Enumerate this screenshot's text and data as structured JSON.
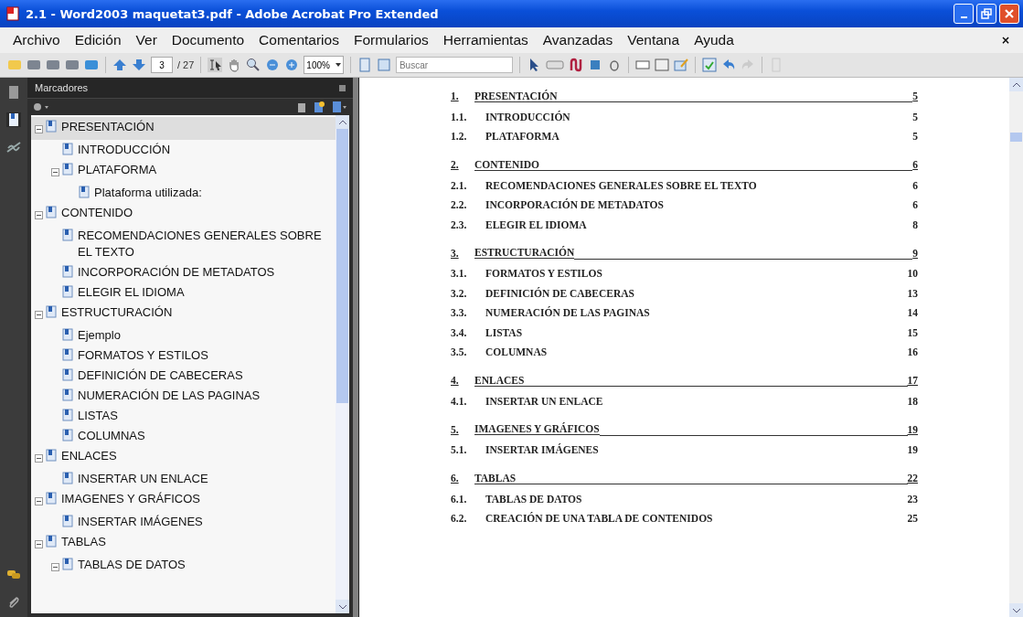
{
  "window": {
    "title": "2.1 - Word2003 maquetat3.pdf - Adobe Acrobat Pro Extended"
  },
  "menu": [
    "Archivo",
    "Edición",
    "Ver",
    "Documento",
    "Comentarios",
    "Formularios",
    "Herramientas",
    "Avanzadas",
    "Ventana",
    "Ayuda"
  ],
  "menu_close": "×",
  "toolbar": {
    "page": "3",
    "page_count": "/ 27",
    "zoom": "100%",
    "search": {
      "placeholder": "Buscar"
    }
  },
  "panel": {
    "title": "Marcadores"
  },
  "bookmarks": [
    {
      "label": "PRESENTACIÓN",
      "selected": true,
      "expanded": true,
      "children": [
        {
          "label": "INTRODUCCIÓN",
          "selected": false
        },
        {
          "label": "PLATAFORMA",
          "selected": false,
          "expanded": true,
          "children": [
            {
              "label": "Plataforma utilizada:",
              "selected": false
            }
          ]
        }
      ]
    },
    {
      "label": "CONTENIDO",
      "selected": false,
      "expanded": true,
      "children": [
        {
          "label": "RECOMENDACIONES GENERALES SOBRE EL TEXTO",
          "selected": false
        },
        {
          "label": "INCORPORACIÓN DE METADATOS",
          "selected": false
        },
        {
          "label": "ELEGIR EL IDIOMA",
          "selected": false
        }
      ]
    },
    {
      "label": "ESTRUCTURACIÓN",
      "selected": false,
      "expanded": true,
      "children": [
        {
          "label": "Ejemplo",
          "selected": false
        },
        {
          "label": "FORMATOS Y ESTILOS",
          "selected": false
        },
        {
          "label": "DEFINICIÓN DE CABECERAS",
          "selected": false
        },
        {
          "label": "NUMERACIÓN DE LAS PAGINAS",
          "selected": false
        },
        {
          "label": "LISTAS",
          "selected": false
        },
        {
          "label": "COLUMNAS",
          "selected": false
        }
      ]
    },
    {
      "label": "ENLACES",
      "selected": false,
      "expanded": true,
      "children": [
        {
          "label": "INSERTAR UN ENLACE",
          "selected": false
        }
      ]
    },
    {
      "label": "IMAGENES Y GRÁFICOS",
      "selected": false,
      "expanded": true,
      "children": [
        {
          "label": "INSERTAR IMÁGENES",
          "selected": false
        }
      ]
    },
    {
      "label": "TABLAS",
      "selected": false,
      "expanded": true,
      "children": [
        {
          "label": "TABLAS DE DATOS",
          "selected": false,
          "expanded": true
        }
      ]
    }
  ],
  "toc": [
    {
      "kind": "chapter",
      "number": "1.",
      "title": "PRESENTACIÓN",
      "page": "5"
    },
    {
      "kind": "section",
      "number": "1.1.",
      "title": "INTRODUCCIÓN",
      "page": "5"
    },
    {
      "kind": "section",
      "number": "1.2.",
      "title": "PLATAFORMA",
      "page": "5"
    },
    {
      "kind": "chapter",
      "number": "2.",
      "title": "CONTENIDO",
      "page": "6"
    },
    {
      "kind": "section",
      "number": "2.1.",
      "title": "RECOMENDACIONES GENERALES SOBRE EL TEXTO",
      "page": "6"
    },
    {
      "kind": "section",
      "number": "2.2.",
      "title": "INCORPORACIÓN DE METADATOS",
      "page": "6"
    },
    {
      "kind": "section",
      "number": "2.3.",
      "title": "ELEGIR EL IDIOMA",
      "page": "8"
    },
    {
      "kind": "chapter",
      "number": "3.",
      "title": "ESTRUCTURACIÓN",
      "page": "9"
    },
    {
      "kind": "section",
      "number": "3.1.",
      "title": "FORMATOS Y ESTILOS",
      "page": "10"
    },
    {
      "kind": "section",
      "number": "3.2.",
      "title": "DEFINICIÓN DE CABECERAS",
      "page": "13"
    },
    {
      "kind": "section",
      "number": "3.3.",
      "title": "NUMERACIÓN DE LAS PAGINAS",
      "page": "14"
    },
    {
      "kind": "section",
      "number": "3.4.",
      "title": "LISTAS",
      "page": "15"
    },
    {
      "kind": "section",
      "number": "3.5.",
      "title": "COLUMNAS",
      "page": "16"
    },
    {
      "kind": "chapter",
      "number": "4.",
      "title": "ENLACES",
      "page": "17"
    },
    {
      "kind": "section",
      "number": "4.1.",
      "title": "INSERTAR UN ENLACE",
      "page": "18"
    },
    {
      "kind": "chapter",
      "number": "5.",
      "title": "IMAGENES Y GRÁFICOS",
      "page": "19"
    },
    {
      "kind": "section",
      "number": "5.1.",
      "title": "INSERTAR IMÁGENES",
      "page": "19"
    },
    {
      "kind": "chapter",
      "number": "6.",
      "title": "TABLAS",
      "page": "22"
    },
    {
      "kind": "section",
      "number": "6.1.",
      "title": "TABLAS DE DATOS",
      "page": "23"
    },
    {
      "kind": "section",
      "number": "6.2.",
      "title": "CREACIÓN DE UNA TABLA DE CONTENIDOS",
      "page": "25"
    }
  ]
}
